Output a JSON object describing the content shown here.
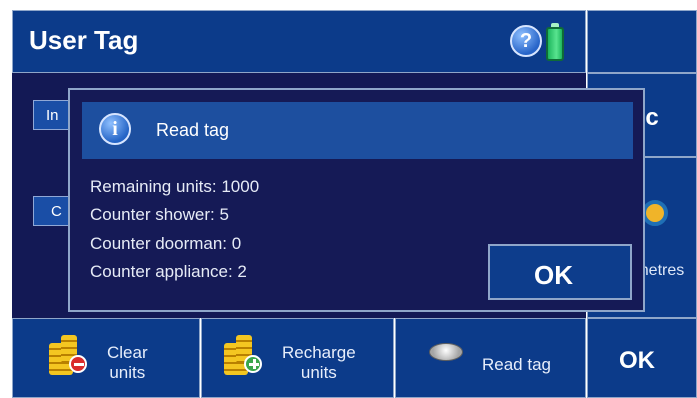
{
  "header": {
    "title": "User Tag"
  },
  "side_buttons": {
    "esc_label": "Esc",
    "units_label": "Centimetres"
  },
  "background_buttons": {
    "top": "In",
    "middle": "C"
  },
  "dialog": {
    "title": "Read tag",
    "lines": [
      "Remaining units: 1000",
      "Counter shower: 5",
      "Counter doorman: 0",
      "Counter appliance: 2"
    ],
    "ok_label": "OK"
  },
  "bottom_bar": {
    "clear_units": "Clear\nunits",
    "recharge_units": "Recharge\nunits",
    "read_tag": "Read tag",
    "ok": "OK"
  },
  "colors": {
    "panel_blue": "#0c3b8a",
    "dark_navy": "#131955",
    "dialog_bg": "#151a56",
    "dialog_header": "#1d4f9f",
    "border": "#8fa6c9",
    "battery_green": "#2ed16f",
    "coin_gold": "#e6b800",
    "minus_red": "#d92b2b",
    "plus_green": "#3aa64b"
  }
}
